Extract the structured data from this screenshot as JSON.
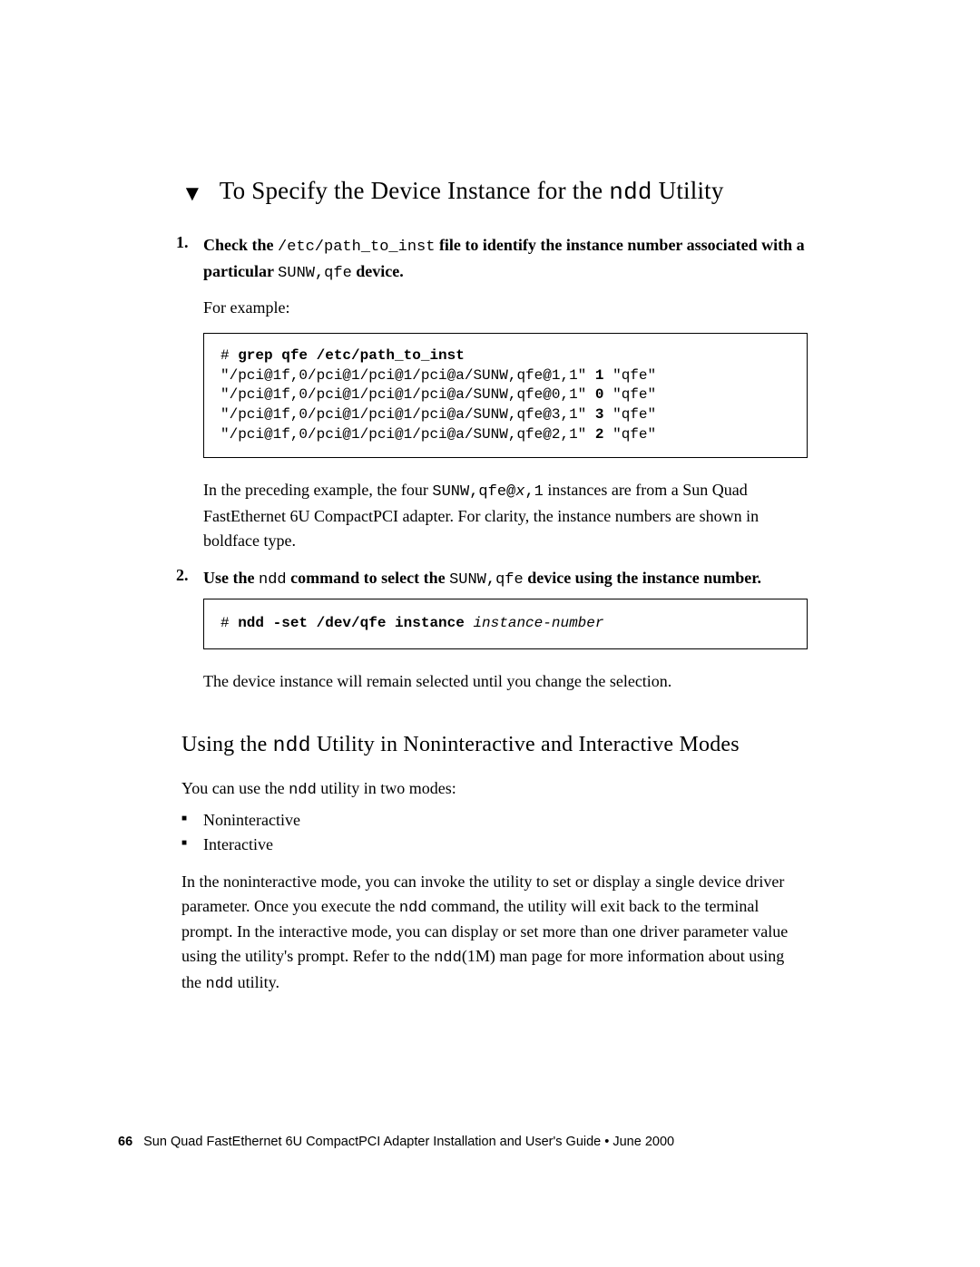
{
  "heading": {
    "pre": "To Specify the Device Instance for the ",
    "mono": "ndd",
    "post": " Utility"
  },
  "step1": {
    "number": "1.",
    "lead_pre": "Check the ",
    "lead_mono": "/etc/path_to_inst",
    "lead_mid": " file to identify the instance number associated with a particular ",
    "lead_mono2": "SUNW,qfe",
    "lead_post": " device.",
    "for_example": "For example:",
    "code_prefix": "# ",
    "code_cmd": "grep qfe /etc/path_to_inst",
    "code_lines": [
      {
        "path": "\"/pci@1f,0/pci@1/pci@1/pci@a/SUNW,qfe@1,1\" ",
        "num": "1",
        "tail": " \"qfe\""
      },
      {
        "path": "\"/pci@1f,0/pci@1/pci@1/pci@a/SUNW,qfe@0,1\" ",
        "num": "0",
        "tail": " \"qfe\""
      },
      {
        "path": "\"/pci@1f,0/pci@1/pci@1/pci@a/SUNW,qfe@3,1\" ",
        "num": "3",
        "tail": " \"qfe\""
      },
      {
        "path": "\"/pci@1f,0/pci@1/pci@1/pci@a/SUNW,qfe@2,1\" ",
        "num": "2",
        "tail": " \"qfe\""
      }
    ],
    "after_pre": "In the preceding example, the four ",
    "after_mono1": "SUNW,qfe@",
    "after_monoi": "x",
    "after_mono2": ",1",
    "after_post": " instances are from a Sun Quad FastEthernet 6U CompactPCI adapter. For clarity, the instance numbers are shown in boldface type."
  },
  "step2": {
    "number": "2.",
    "lead_pre": "Use the ",
    "lead_mono1": "ndd",
    "lead_mid": " command to select the ",
    "lead_mono2": "SUNW,qfe",
    "lead_post": " device using the instance number.",
    "code_prefix": "# ",
    "code_cmd": "ndd -set /dev/qfe instance",
    "code_arg": " instance-number",
    "after": "The device instance will remain selected until you change the selection."
  },
  "sub": {
    "pre": "Using the ",
    "mono": "ndd",
    "post": " Utility in Noninteractive and Interactive Modes"
  },
  "modes_intro_pre": "You can use the ",
  "modes_intro_mono": "ndd",
  "modes_intro_post": " utility in two modes:",
  "bullets": [
    "Noninteractive",
    "Interactive"
  ],
  "modes_para": {
    "p1": "In the noninteractive mode, you can invoke the utility to set or display a single device driver parameter. Once you execute the ",
    "m1": "ndd",
    "p2": " command, the utility will exit back to the terminal prompt. In the interactive mode, you can display or set more than one driver parameter value using the utility's prompt. Refer to the ",
    "m2": "ndd",
    "p3": "(1M) man page for more information about using the ",
    "m3": "ndd",
    "p4": " utility."
  },
  "footer": {
    "page": "66",
    "title": "Sun Quad FastEthernet 6U CompactPCI Adapter Installation and User's Guide  •  June 2000"
  }
}
